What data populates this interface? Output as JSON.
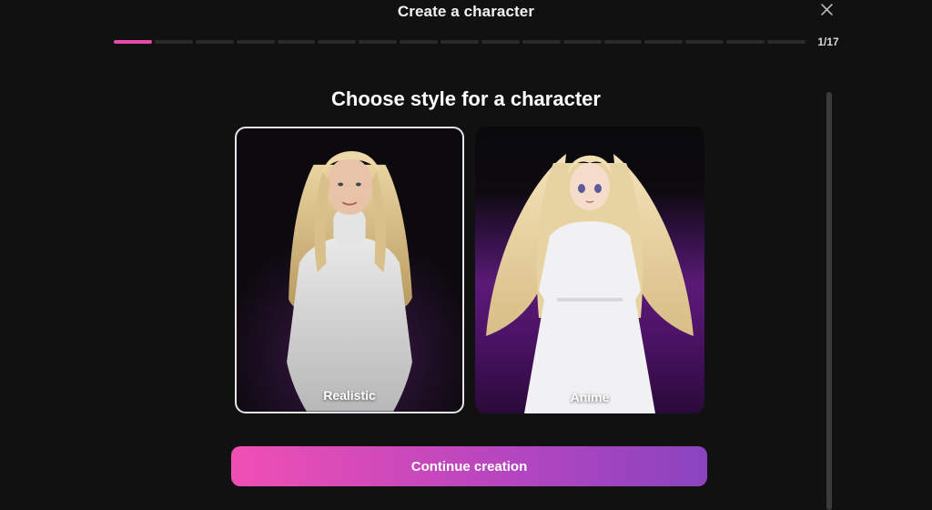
{
  "header": {
    "title": "Create a character",
    "close_icon": "close-icon"
  },
  "progress": {
    "current_step": 1,
    "total_steps": 17,
    "label": "1/17",
    "active_color": "#e84aa8"
  },
  "main": {
    "title": "Choose style for a character",
    "styles": [
      {
        "label": "Realistic",
        "selected": true
      },
      {
        "label": "Anime",
        "selected": false
      }
    ]
  },
  "footer": {
    "continue_label": "Continue creation",
    "gradient": [
      "#f04fb4",
      "#8a44bf"
    ]
  }
}
